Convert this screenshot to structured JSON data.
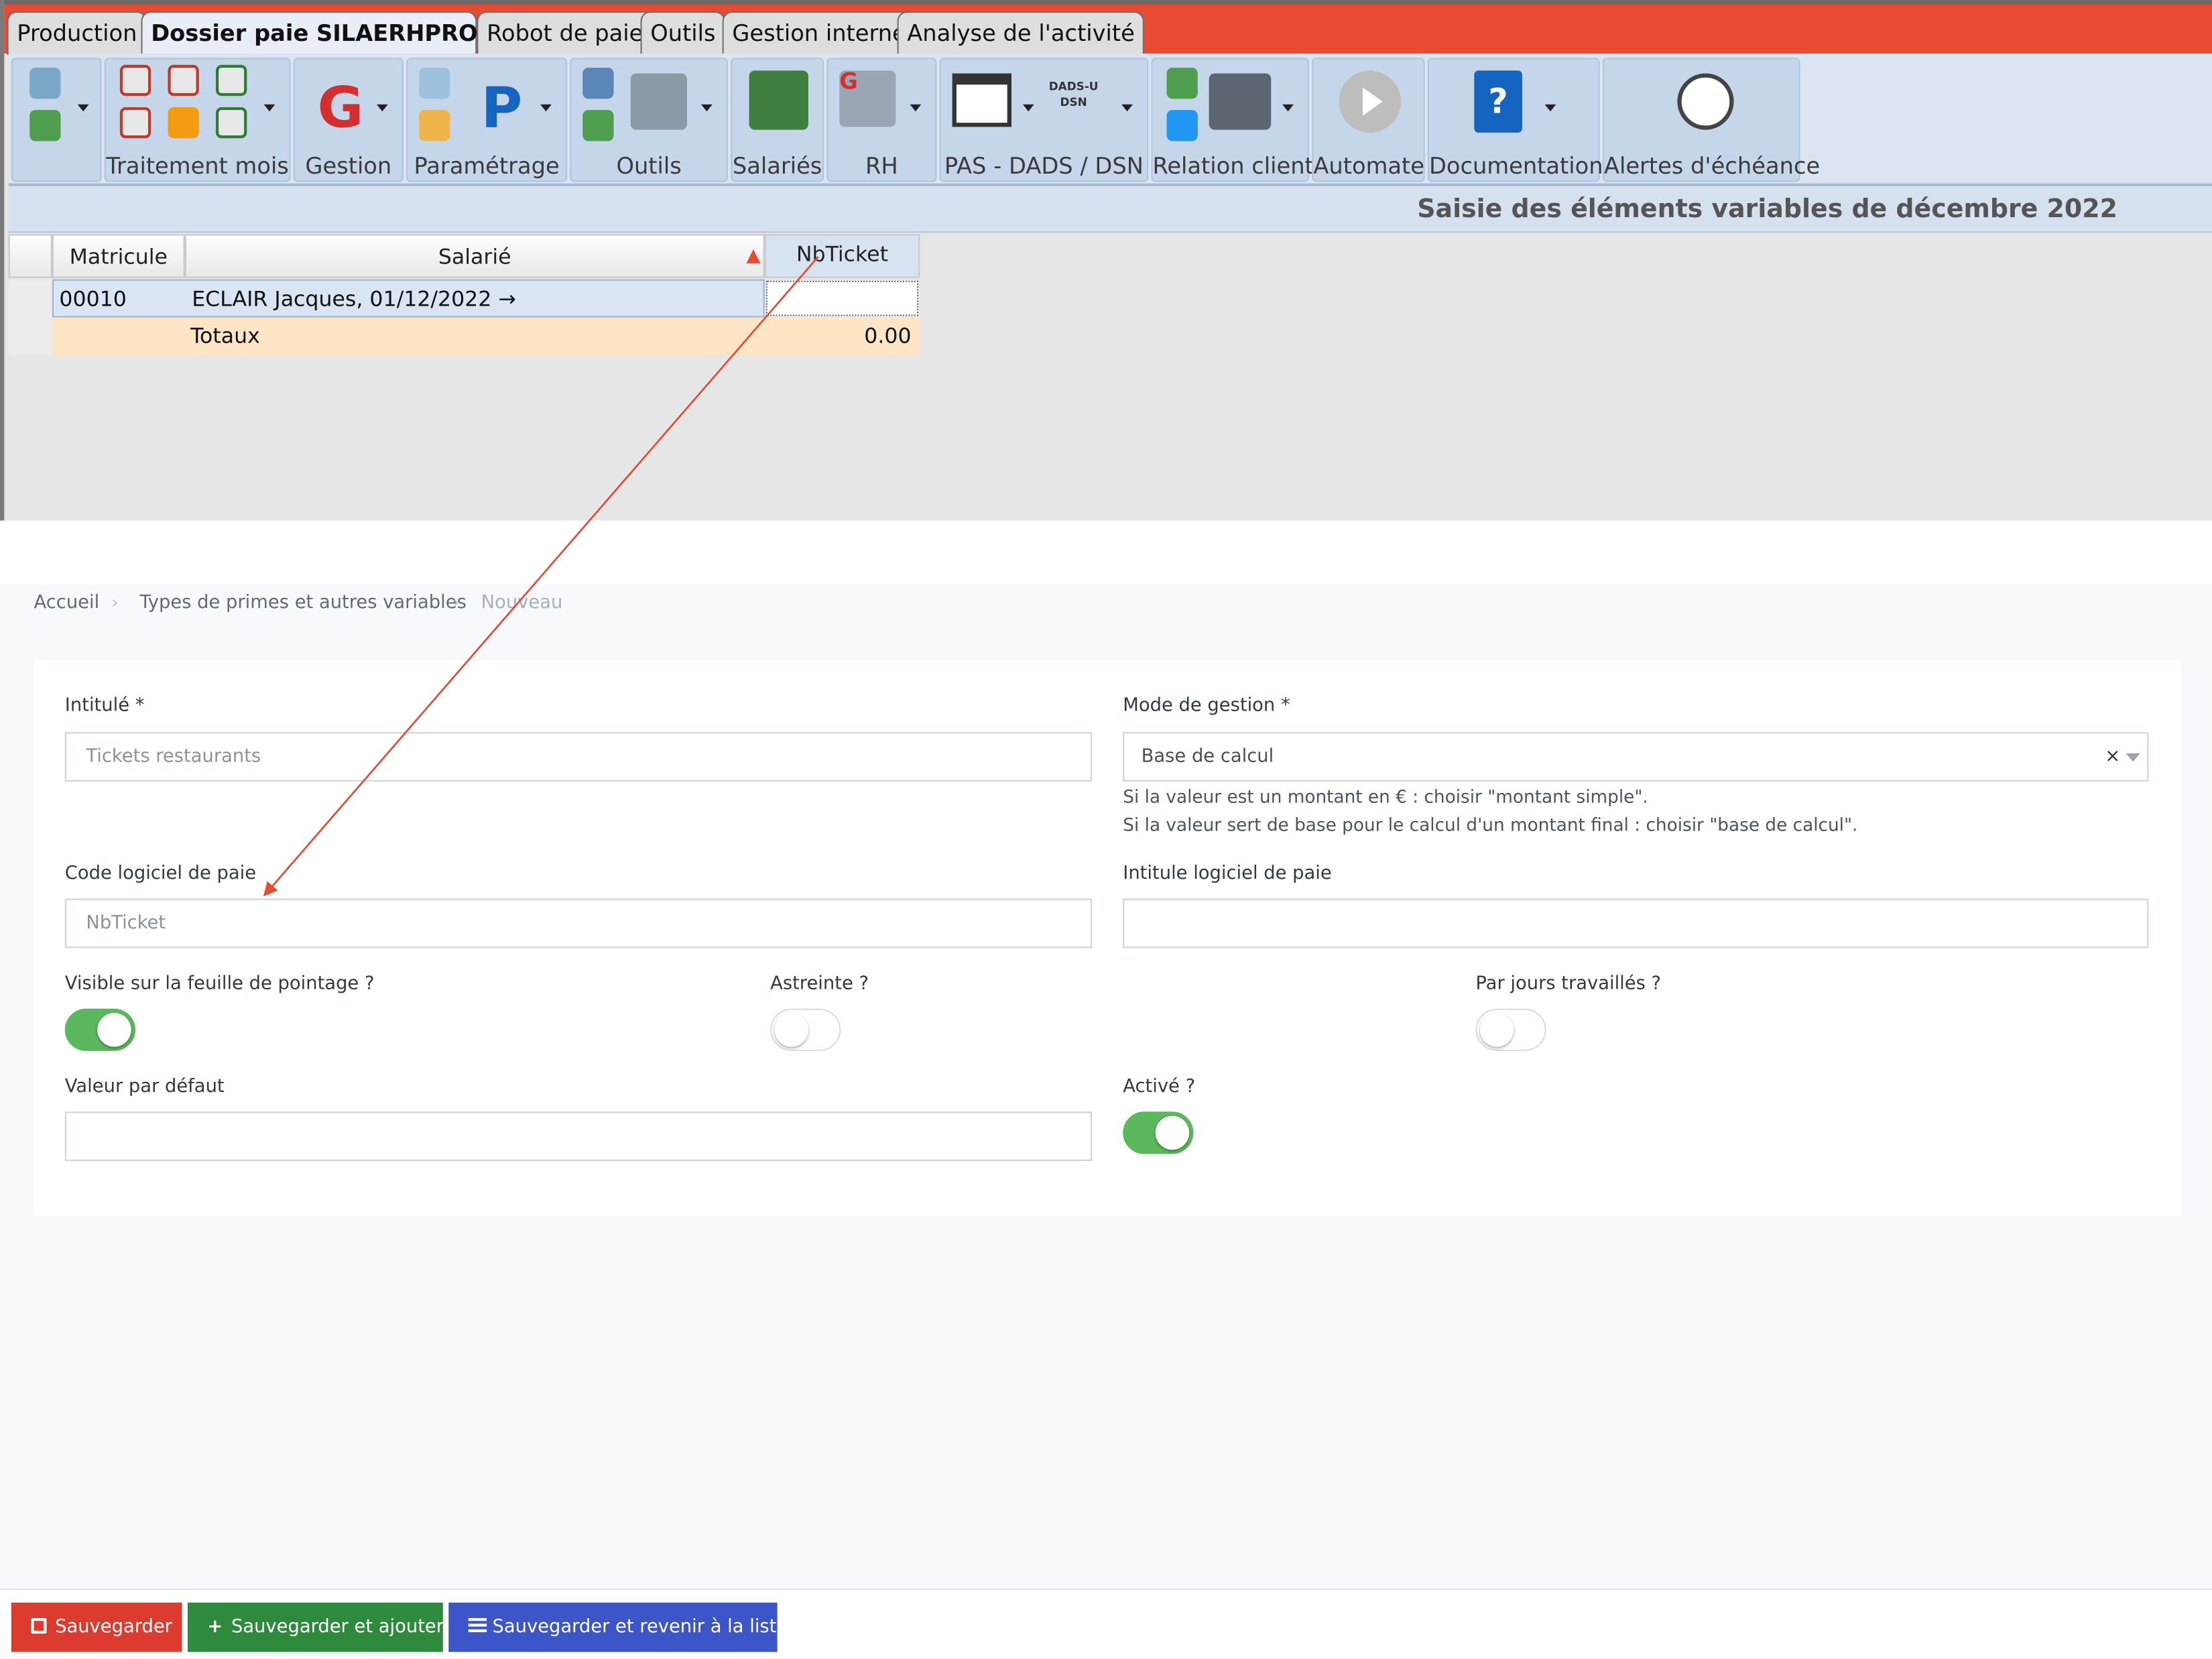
{
  "tabs": [
    {
      "label": "Production"
    },
    {
      "label": "Dossier paie SILAERHPRO"
    },
    {
      "label": "Robot de paie"
    },
    {
      "label": "Outils"
    },
    {
      "label": "Gestion interne"
    },
    {
      "label": "Analyse de l'activité"
    }
  ],
  "ribbon": {
    "groups": [
      {
        "label": ""
      },
      {
        "label": "Traitement mois"
      },
      {
        "label": "Gestion"
      },
      {
        "label": "Paramétrage"
      },
      {
        "label": "Outils"
      },
      {
        "label": "Salariés"
      },
      {
        "label": "RH"
      },
      {
        "label": "PAS - DADS / DSN"
      },
      {
        "label": "Relation client"
      },
      {
        "label": "Automate"
      },
      {
        "label": "Documentation"
      },
      {
        "label": "Alertes d'échéance"
      }
    ],
    "gestion_glyph": "G",
    "parametrage_glyph": "P",
    "dsn_icon_text": "DADS-U DSN",
    "rh_glyph": "G"
  },
  "page_heading": "Saisie des éléments variables de décembre 2022",
  "grid": {
    "columns": [
      "Matricule",
      "Salarié",
      "NbTicket"
    ],
    "sort_indicator": "▲",
    "rows": [
      {
        "matricule": "00010",
        "salarie": "ECLAIR Jacques, 01/12/2022 →",
        "nbticket": ""
      }
    ],
    "totals": {
      "label": "Totaux",
      "value": "0.00"
    }
  },
  "breadcrumb": {
    "items": [
      "Accueil",
      "Types de primes et autres variables",
      "Nouveau"
    ],
    "separator": "›"
  },
  "form": {
    "intitule_label": "Intitulé *",
    "intitule_placeholder": "Tickets restaurants",
    "mode_label": "Mode de gestion *",
    "mode_value": "Base de calcul",
    "mode_clear": "×",
    "mode_hint_1": "Si la valeur est un montant en € : choisir \"montant simple\".",
    "mode_hint_2": "Si la valeur sert de base pour le calcul d'un montant final : choisir \"base de calcul\".",
    "code_label": "Code logiciel de paie",
    "code_placeholder": "NbTicket",
    "intitule_logiciel_label": "Intitule logiciel de paie",
    "intitule_logiciel_value": "",
    "visible_label": "Visible sur la feuille de pointage ?",
    "visible_on": true,
    "astreinte_label": "Astreinte ?",
    "astreinte_on": false,
    "par_jours_label": "Par jours travaillés ?",
    "par_jours_on": false,
    "defaut_label": "Valeur par défaut",
    "defaut_value": "",
    "active_label": "Activé ?",
    "active_on": true
  },
  "footer": {
    "save_icon": "floppy-icon",
    "save": "Sauvegarder",
    "save_add_icon": "+",
    "save_add": "Sauvegarder et ajouter",
    "save_list_icon": "list-icon",
    "save_list": "Sauvegarder et revenir à la liste"
  },
  "colors": {
    "tabbar": "#e94a32",
    "annotation_arrow": "#e94a32",
    "toggle_on": "#5cb85c",
    "btn_save": "#dd3b2f",
    "btn_save_add": "#2e8b3e",
    "btn_save_list": "#3c55c8"
  }
}
